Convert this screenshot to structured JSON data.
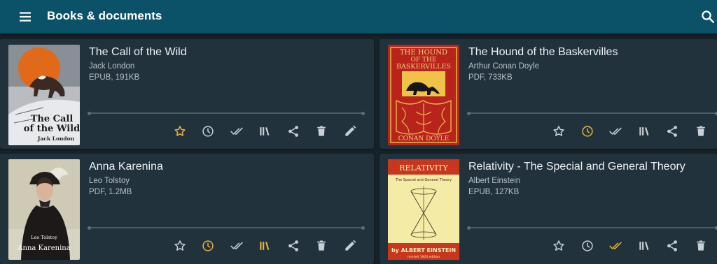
{
  "appbar": {
    "title": "Books & documents",
    "background": "#0b5268"
  },
  "icons": {
    "menu": "hamburger-menu-icon",
    "search": "search-icon",
    "favorite": "star-icon",
    "reading": "clock-icon",
    "finished": "double-check-icon",
    "shelf": "library-icon",
    "share": "share-icon",
    "delete": "trash-icon",
    "edit": "pencil-icon"
  },
  "colors": {
    "icon_default": "#c8d0d5",
    "icon_active": "#e6b23d"
  },
  "books": [
    {
      "title": "The Call of the Wild",
      "author": "Jack London",
      "meta": "EPUB, 191KB",
      "cover_title_line1": "The Call",
      "cover_title_line2": "of the Wild",
      "cover_author": "Jack London",
      "active": {
        "favorite": true,
        "reading": false,
        "finished": false,
        "shelf": false
      }
    },
    {
      "title": "The Hound of the Baskervilles",
      "author": "Arthur Conan Doyle",
      "meta": "PDF, 733KB",
      "cover_title_line1": "THE HOUND",
      "cover_title_line2": "OF THE",
      "cover_title_line3": "BASKERVILLES",
      "cover_author": "CONAN DOYLE",
      "active": {
        "favorite": false,
        "reading": true,
        "finished": false,
        "shelf": false
      }
    },
    {
      "title": "Anna Karenina",
      "author": "Leo Tolstoy",
      "meta": "PDF, 1.2MB",
      "cover_author": "Leo Tolstoy",
      "cover_title": "Anna Karenina",
      "active": {
        "favorite": false,
        "reading": true,
        "finished": false,
        "shelf": true
      }
    },
    {
      "title": "Relativity - The Special and General Theory",
      "author": "Albert Einstein",
      "meta": "EPUB, 127KB",
      "cover_title": "RELATIVITY",
      "cover_subtitle": "The Special and General Theory",
      "cover_author": "by ALBERT EINSTEIN",
      "cover_edition": "revised 1924 edition",
      "active": {
        "favorite": false,
        "reading": false,
        "finished": true,
        "shelf": false
      }
    }
  ]
}
